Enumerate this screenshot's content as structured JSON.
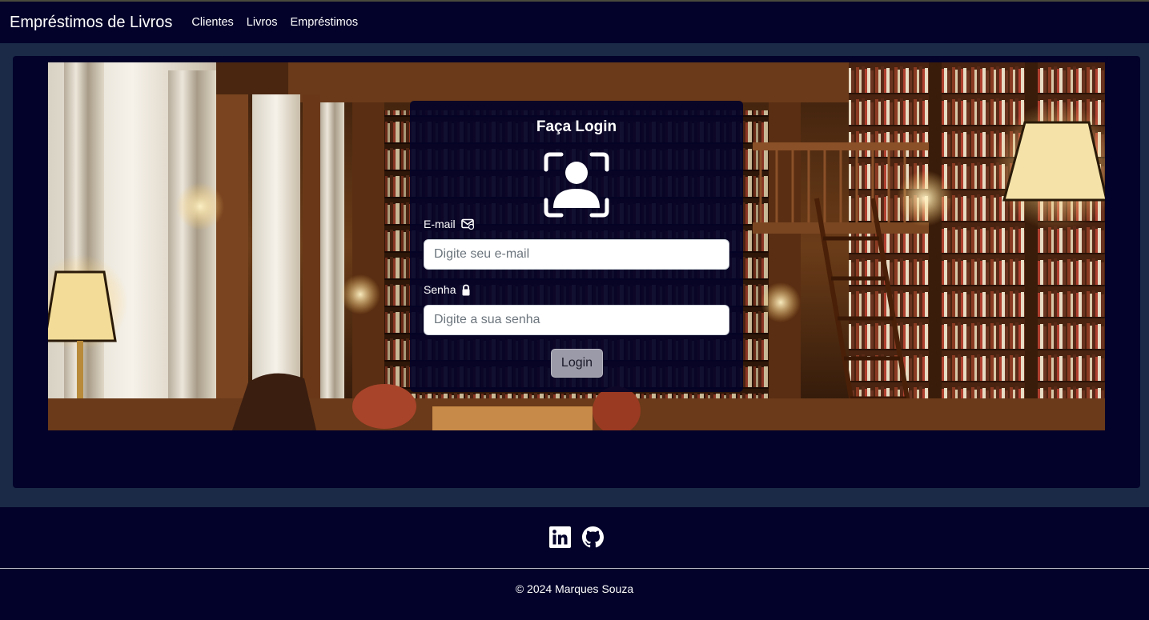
{
  "navbar": {
    "brand": "Empréstimos de Livros",
    "links": [
      "Clientes",
      "Livros",
      "Empréstimos"
    ]
  },
  "login": {
    "title": "Faça Login",
    "email_label": "E-mail",
    "email_placeholder": "Digite seu e-mail",
    "password_label": "Senha",
    "password_placeholder": "Digite a sua senha",
    "submit_label": "Login"
  },
  "footer": {
    "social_icons": [
      "linkedin-icon",
      "github-icon"
    ],
    "copyright": "© 2024 Marques Souza"
  },
  "colors": {
    "navbar_bg": "#03022a",
    "page_bg": "#1a2a47",
    "button_bg": "#9a9aa8"
  }
}
